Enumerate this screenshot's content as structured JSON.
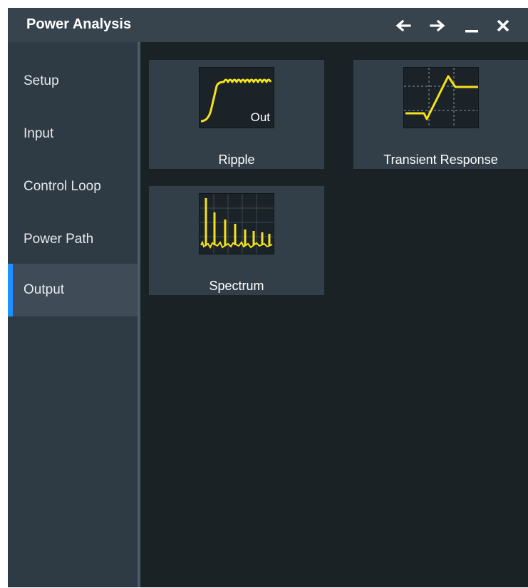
{
  "window": {
    "title": "Power Analysis",
    "buttons": [
      "back-arrow",
      "forward-arrow",
      "minimize",
      "close"
    ]
  },
  "sidebar": {
    "items": [
      {
        "label": "Setup"
      },
      {
        "label": "Input"
      },
      {
        "label": "Control Loop"
      },
      {
        "label": "Power Path"
      },
      {
        "label": "Output"
      }
    ],
    "active": "Output"
  },
  "tiles": [
    {
      "label": "Ripple",
      "thumb_text": "Out",
      "icon": "ripple-waveform-icon"
    },
    {
      "label": "Transient Response",
      "icon": "transient-response-icon"
    },
    {
      "label": "Spectrum",
      "icon": "spectrum-icon"
    }
  ],
  "colors": {
    "accent": "#1e90ff",
    "waveform": "#f5e21b",
    "panel": "#2e3a44",
    "content": "#1b2226"
  }
}
